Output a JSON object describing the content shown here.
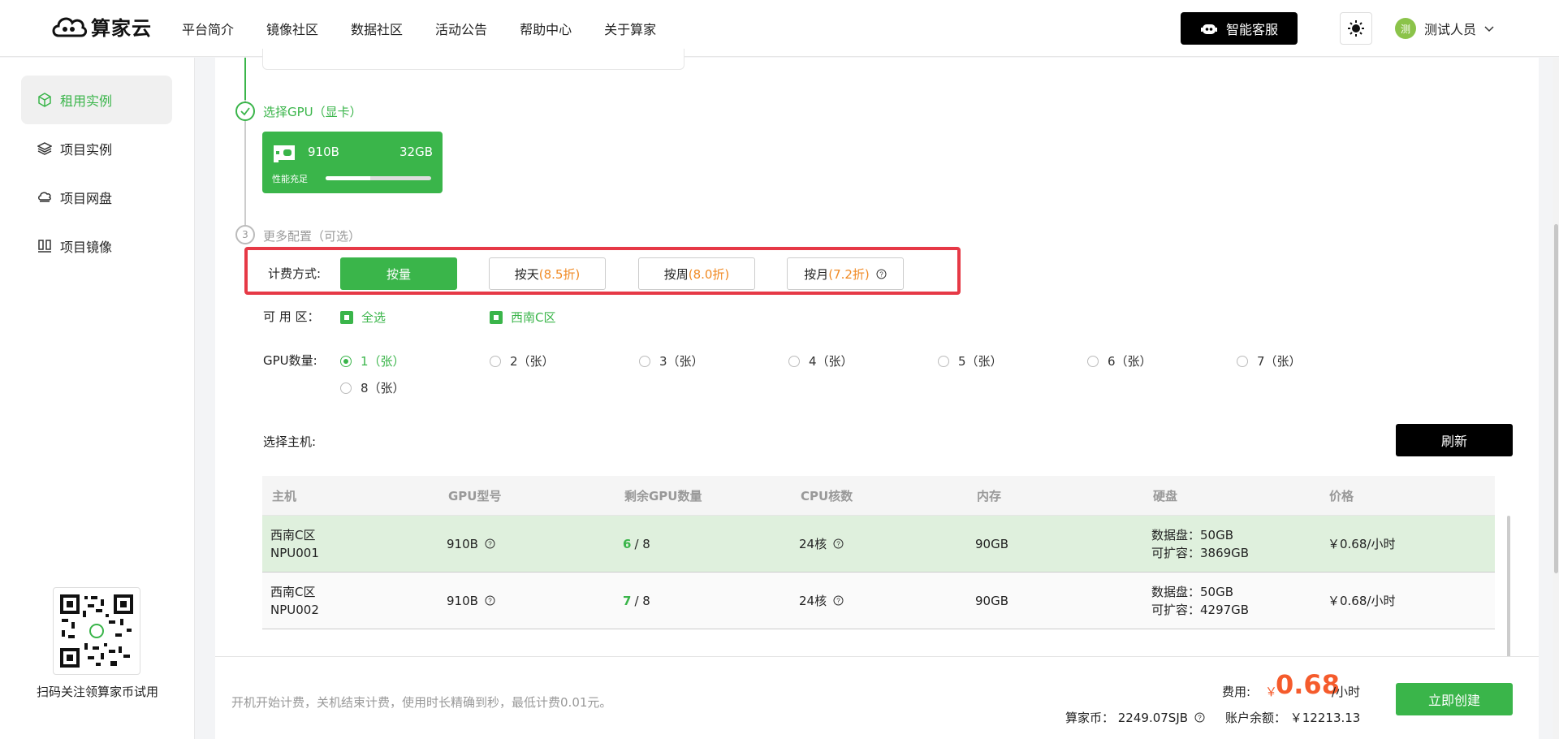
{
  "header": {
    "logo_text": "算家云",
    "nav": [
      "平台简介",
      "镜像社区",
      "数据社区",
      "活动公告",
      "帮助中心",
      "关于算家"
    ],
    "service_label": "智能客服",
    "avatar_text": "测",
    "user_name": "测试人员"
  },
  "sidebar": {
    "items": [
      {
        "label": "租用实例",
        "icon": "cube-icon",
        "active": true
      },
      {
        "label": "项目实例",
        "icon": "layers-icon",
        "active": false
      },
      {
        "label": "项目网盘",
        "icon": "cloud-drive-icon",
        "active": false
      },
      {
        "label": "项目镜像",
        "icon": "image-icon",
        "active": false
      }
    ],
    "qr_caption": "扫码关注领算家币试用"
  },
  "steps": {
    "gpu_title": "选择GPU（显卡）",
    "more_number": "3",
    "more_title": "更多配置（可选）"
  },
  "gpu_card": {
    "model": "910B",
    "memory": "32GB",
    "perf_label": "性能充足",
    "perf_level": 0.42
  },
  "billing": {
    "label": "计费方式:",
    "options": [
      {
        "name": "按量",
        "discount": "",
        "active": true
      },
      {
        "name": "按天",
        "discount": "(8.5折)",
        "active": false
      },
      {
        "name": "按周",
        "discount": "(8.0折)",
        "active": false
      },
      {
        "name": "按月",
        "discount": "(7.2折)",
        "active": false
      }
    ]
  },
  "zone": {
    "label": "可 用 区：",
    "options": [
      "全选",
      "西南C区"
    ]
  },
  "gpu_count": {
    "label": "GPU数量:",
    "options": [
      "1（张）",
      "2（张）",
      "3（张）",
      "4（张）",
      "5（张）",
      "6（张）",
      "7（张）",
      "8（张）"
    ],
    "selected": 0
  },
  "host": {
    "label": "选择主机:",
    "refresh_label": "刷新"
  },
  "table": {
    "headers": [
      "主机",
      "GPU型号",
      "剩余GPU数量",
      "CPU核数",
      "内存",
      "硬盘",
      "价格"
    ],
    "rows": [
      {
        "host_zone": "西南C区",
        "host_id": "NPU001",
        "gpu": "910B",
        "remaining": "6",
        "total": "/ 8",
        "cpu": "24核",
        "mem": "90GB",
        "disk": "数据盘：50GB",
        "expand": "可扩容：3869GB",
        "price": "￥0.68/小时",
        "selected": true
      },
      {
        "host_zone": "西南C区",
        "host_id": "NPU002",
        "gpu": "910B",
        "remaining": "7",
        "total": "/ 8",
        "cpu": "24核",
        "mem": "90GB",
        "disk": "数据盘：50GB",
        "expand": "可扩容：4297GB",
        "price": "￥0.68/小时",
        "selected": false
      }
    ]
  },
  "footer": {
    "note": "开机开始计费，关机结束计费，使用时长精确到秒，最低计费0.01元。",
    "fee_label": "费用:",
    "fee_currency": "￥",
    "fee_value": "0.68",
    "fee_unit": "/小时",
    "coins": "算家币： 2249.07SJB",
    "balance": "账户余额： ￥12213.13",
    "create_label": "立即创建"
  },
  "colors": {
    "accent": "#3ab54a",
    "highlight": "#e63946",
    "discount": "#f08a24",
    "price": "#f55b2c"
  }
}
